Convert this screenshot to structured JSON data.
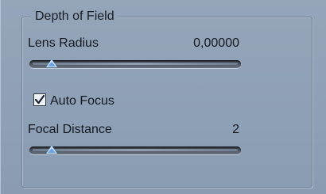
{
  "group": {
    "title": "Depth of Field"
  },
  "lens_radius": {
    "label": "Lens Radius",
    "value": "0,00000",
    "slider_fraction": 0.06
  },
  "auto_focus": {
    "label": "Auto Focus",
    "checked": true
  },
  "focal_distance": {
    "label": "Focal Distance",
    "value": "2",
    "slider_fraction": 0.06
  }
}
